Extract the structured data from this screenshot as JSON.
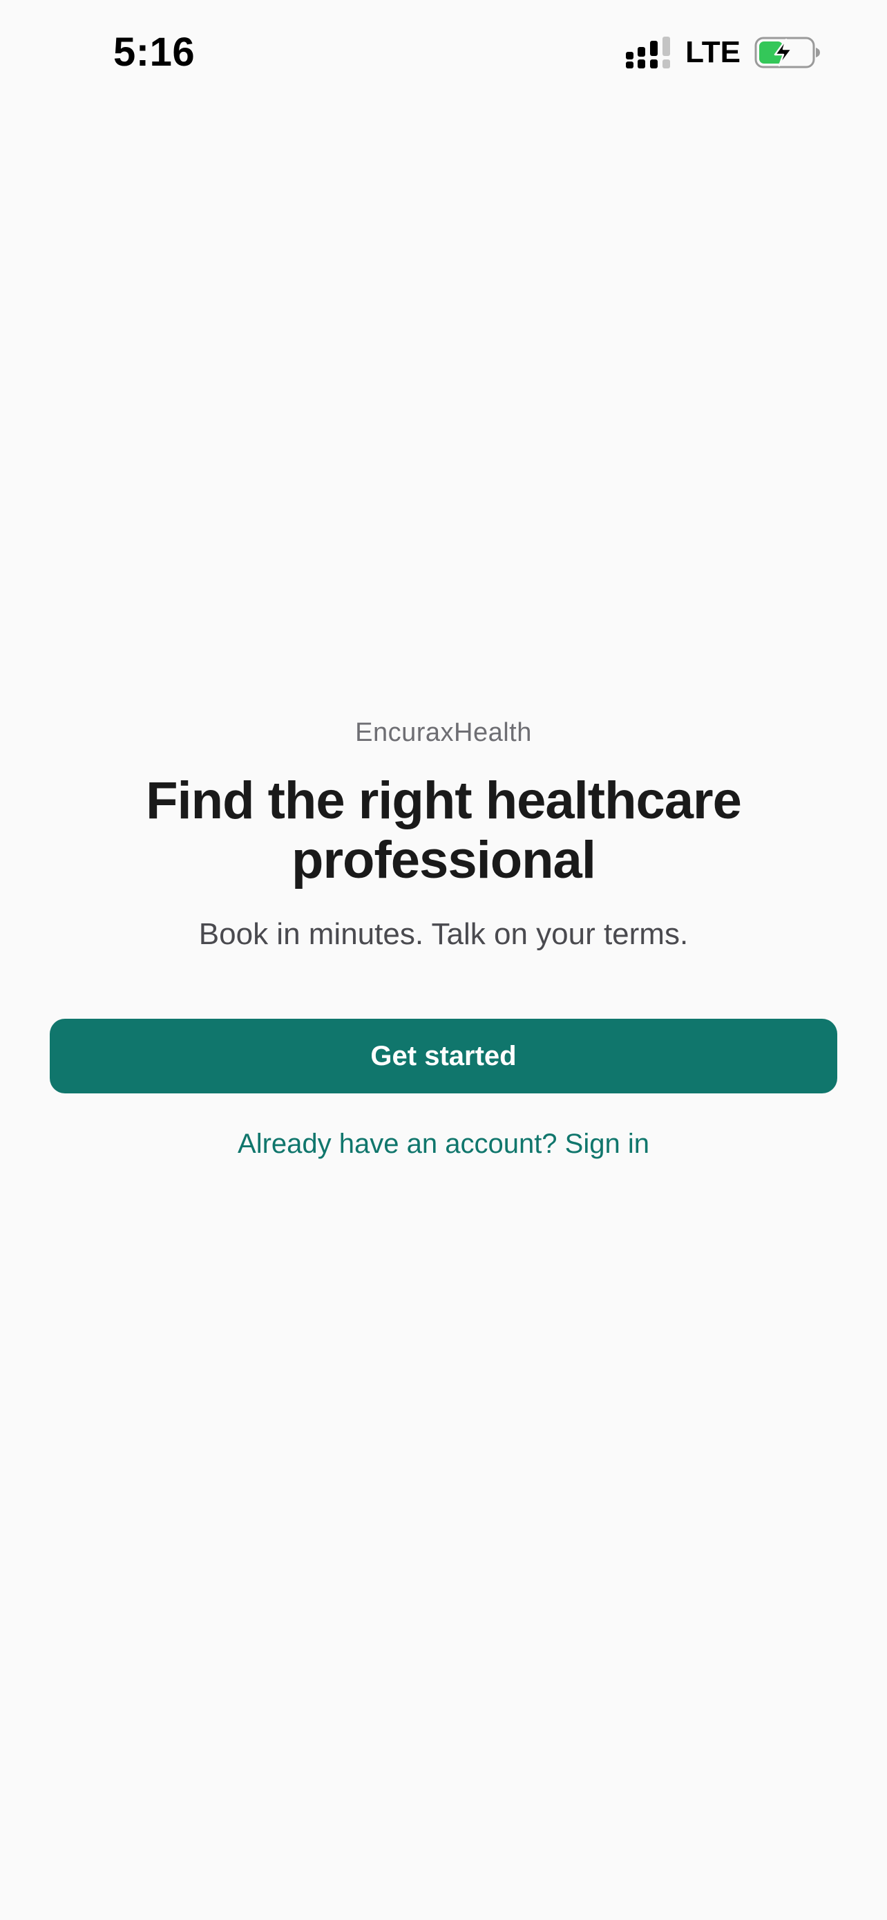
{
  "status_bar": {
    "time": "5:16",
    "network": "LTE",
    "icons": [
      "signal-icon",
      "battery-charging-icon"
    ],
    "battery_color": "#34c759"
  },
  "welcome": {
    "brand": "EncuraxHealth",
    "headline": "Find the right healthcare professional",
    "subheadline": "Book in minutes. Talk on your terms."
  },
  "actions": {
    "get_started_label": "Get started",
    "sign_in_label": "Already have an account? Sign in"
  },
  "colors": {
    "accent": "#10766c",
    "background": "#fafafa",
    "headline": "#1a1a1a",
    "secondary_text": "#6e6e73"
  }
}
